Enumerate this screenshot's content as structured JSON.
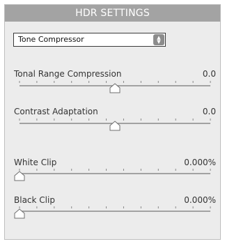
{
  "panel": {
    "title": "HDR SETTINGS"
  },
  "method": {
    "selected": "Tone Compressor"
  },
  "sliders": [
    {
      "label": "Tonal Range Compression",
      "value": "0.0",
      "position": 0.5
    },
    {
      "label": "Contrast Adaptation",
      "value": "0.0",
      "position": 0.5
    },
    {
      "label": "White Clip",
      "value": "0.000%",
      "position": 0.0
    },
    {
      "label": "Black Clip",
      "value": "0.000%",
      "position": 0.0
    }
  ],
  "colors": {
    "header_bg": "#a3a3a3",
    "panel_bg": "#ececec",
    "track": "#8a8a8a",
    "thumb_fill": "#ffffff",
    "thumb_stroke": "#6f6f6f"
  }
}
